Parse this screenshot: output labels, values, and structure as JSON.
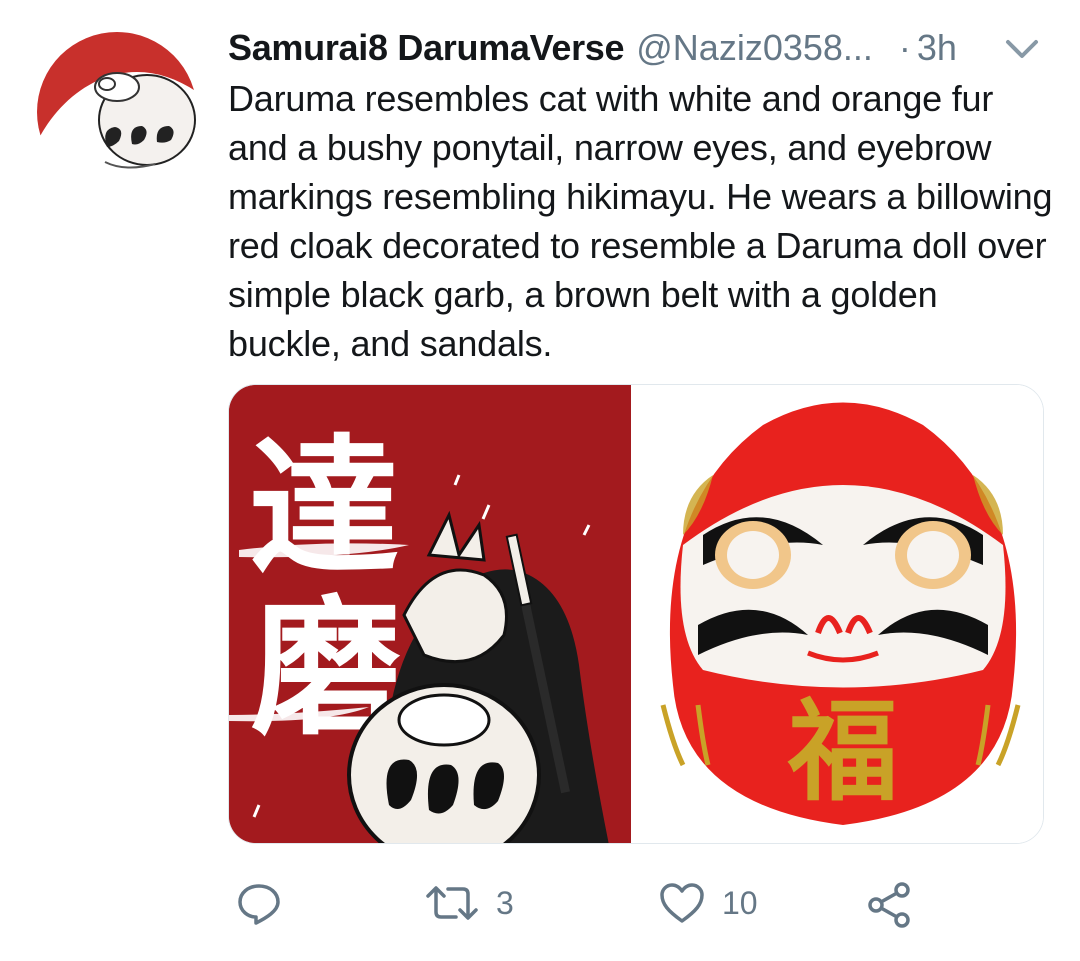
{
  "tweet": {
    "author": {
      "display_name": "Samurai8 DarumaVerse",
      "handle": "@Naziz0358...",
      "avatar_icon": "daruma-avatar"
    },
    "separator": "·",
    "timestamp": "3h",
    "text": "Daruma resembles cat with white and orange fur and a bushy ponytail, narrow eyes, and eyebrow markings resembling hikimayu. He wears a billowing red cloak decorated to resemble a Daruma doll over simple black garb, a brown belt with a golden buckle, and sandals.",
    "media": {
      "left_image_chars": [
        "達",
        "磨"
      ],
      "right_image_char": "福"
    },
    "actions": {
      "reply_icon": "reply-icon",
      "retweet_icon": "retweet-icon",
      "retweet_count": "3",
      "like_icon": "heart-icon",
      "like_count": "10",
      "share_icon": "share-icon"
    }
  },
  "colors": {
    "text_primary": "#14171a",
    "text_secondary": "#657786",
    "media_red": "#a31a1e",
    "daruma_red": "#e8221e",
    "gold": "#c9a227"
  }
}
